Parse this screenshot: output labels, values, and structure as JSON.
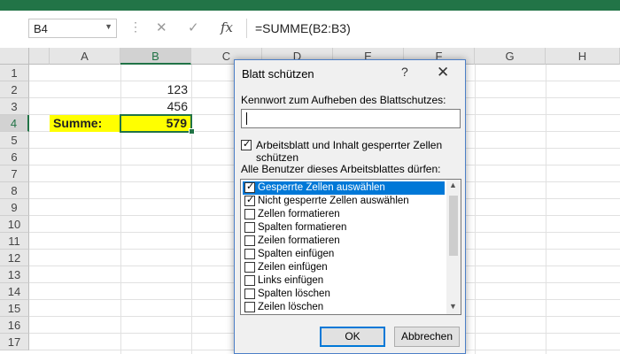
{
  "formula_bar": {
    "name_box": "B4",
    "cancel_glyph": "✕",
    "enter_glyph": "✓",
    "fx_label": "fx",
    "formula": "=SUMME(B2:B3)"
  },
  "columns": [
    "A",
    "B",
    "C",
    "D",
    "E",
    "F",
    "G",
    "H"
  ],
  "rows": [
    "1",
    "2",
    "3",
    "4",
    "5",
    "6",
    "7",
    "8",
    "9",
    "10",
    "11",
    "12",
    "13",
    "14",
    "15",
    "16",
    "17"
  ],
  "selected_column": "B",
  "selected_row": "4",
  "cells": {
    "b2": "123",
    "b3": "456",
    "a4": "Summe:",
    "b4": "579"
  },
  "dialog": {
    "title": "Blatt schützen",
    "help": "?",
    "close": "✕",
    "password_label": "Kennwort zum Aufheben des Blattschutzes:",
    "password_value": "",
    "protect_label": "Arbeitsblatt und Inhalt gesperrter Zellen schützen",
    "protect_checked": true,
    "allow_label": "Alle Benutzer dieses Arbeitsblattes dürfen:",
    "permissions": [
      {
        "label": "Gesperrte Zellen auswählen",
        "checked": true,
        "highlighted": true
      },
      {
        "label": "Nicht gesperrte Zellen auswählen",
        "checked": true,
        "highlighted": false
      },
      {
        "label": "Zellen formatieren",
        "checked": false,
        "highlighted": false
      },
      {
        "label": "Spalten formatieren",
        "checked": false,
        "highlighted": false
      },
      {
        "label": "Zeilen formatieren",
        "checked": false,
        "highlighted": false
      },
      {
        "label": "Spalten einfügen",
        "checked": false,
        "highlighted": false
      },
      {
        "label": "Zeilen einfügen",
        "checked": false,
        "highlighted": false
      },
      {
        "label": "Links einfügen",
        "checked": false,
        "highlighted": false
      },
      {
        "label": "Spalten löschen",
        "checked": false,
        "highlighted": false
      },
      {
        "label": "Zeilen löschen",
        "checked": false,
        "highlighted": false
      }
    ],
    "ok_label": "OK",
    "cancel_label": "Abbrechen"
  },
  "colors": {
    "accent": "#217346",
    "highlight": "#0078d7",
    "summary_fill": "#ffff00"
  },
  "icons": {
    "namebox_dropdown": "chevron-down-icon",
    "cancel": "close-icon",
    "enter": "check-icon",
    "function": "function-icon"
  }
}
